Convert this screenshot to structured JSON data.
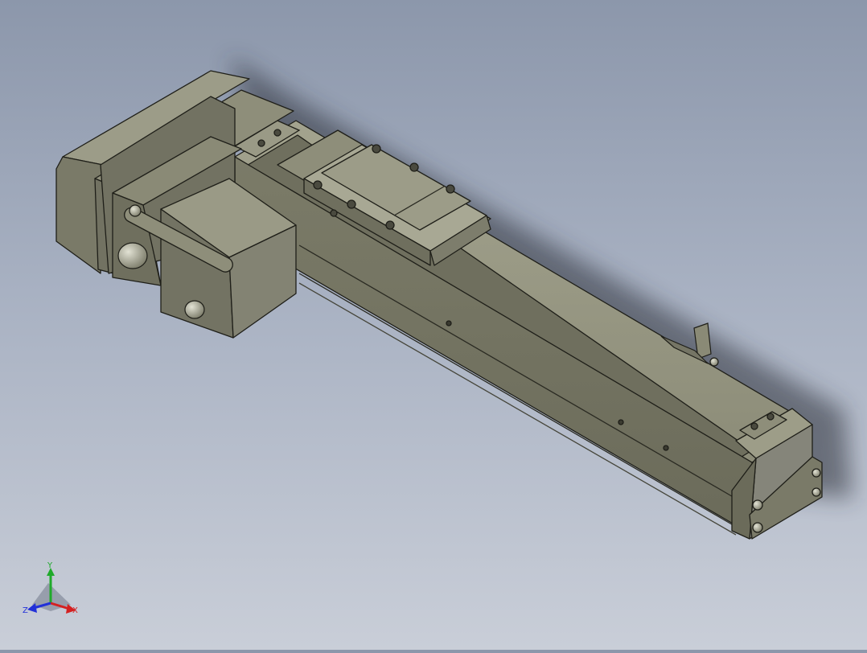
{
  "triad": {
    "x_label": "X",
    "y_label": "Y",
    "z_label": "Z",
    "x_color": "#d42020",
    "y_color": "#1faa2a",
    "z_color": "#2230d8"
  },
  "model": {
    "body_color": "#7a7a68",
    "dark_color": "#3e3e36",
    "light_color": "#9b9b86",
    "highlight_color": "#b8b8a4"
  }
}
